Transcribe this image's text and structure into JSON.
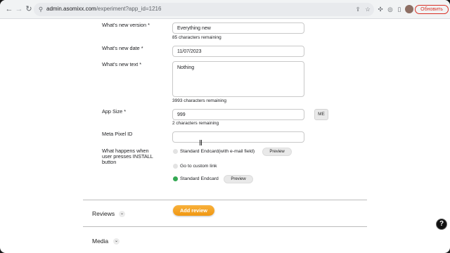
{
  "browser": {
    "url_host": "admin.asomixx.com",
    "url_path": "/experiment?app_id=1216",
    "update_label": "Обновить",
    "icons": [
      "back-icon",
      "forward-icon",
      "reload-icon",
      "site-info-icon",
      "share-icon",
      "star-icon",
      "extensions-icon",
      "sync-icon",
      "sidebar-icon",
      "avatar",
      "menu-icon"
    ]
  },
  "form": {
    "whats_new_version": {
      "label": "What's new version *",
      "value": "Everything new",
      "hint": "85 characters remaining"
    },
    "whats_new_date": {
      "label": "What's new date *",
      "value": "11/07/2023"
    },
    "whats_new_text": {
      "label": "What's new text *",
      "value": "Nothing",
      "hint": "3993 characters remaining"
    },
    "app_size": {
      "label": "App Size *",
      "value": "999",
      "hint": "2 characters remaining",
      "unit_button": "ME"
    },
    "meta_pixel": {
      "label": "Meta Pixel ID",
      "value": ""
    },
    "install_action": {
      "label": "What happens when user presses INSTALL button",
      "options": [
        {
          "label": "Standard Endcard(with e-mail field)",
          "selected": false,
          "preview": "Preview"
        },
        {
          "label": "Go to custom link",
          "selected": false
        },
        {
          "label": "Standard Endcard",
          "selected": true,
          "preview": "Preview"
        }
      ]
    }
  },
  "sections": {
    "reviews": "Reviews",
    "add_review": "Add review",
    "media": "Media"
  },
  "help_label": "?",
  "colors": {
    "accent": "#f5a623",
    "selected_radio": "#34a853",
    "update_red": "#d93025"
  }
}
